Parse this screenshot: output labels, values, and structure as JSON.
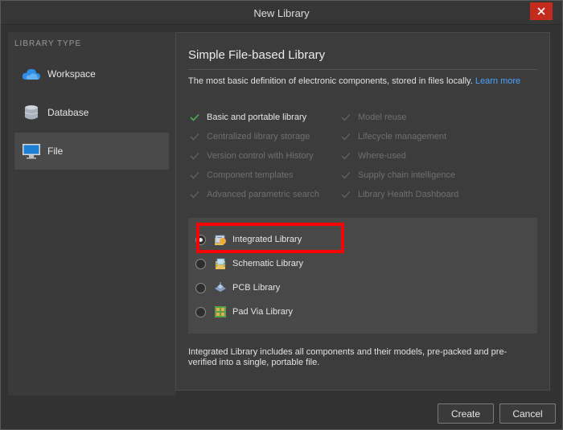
{
  "window": {
    "title": "New Library"
  },
  "sidebar": {
    "section_label": "LIBRARY TYPE",
    "items": [
      {
        "label": "Workspace",
        "icon": "cloud-icon",
        "active": false
      },
      {
        "label": "Database",
        "icon": "database-icon",
        "active": false
      },
      {
        "label": "File",
        "icon": "monitor-icon",
        "active": true
      }
    ]
  },
  "content": {
    "heading": "Simple File-based Library",
    "description": "The most basic definition of electronic components, stored in files locally.",
    "learn_more": "Learn more",
    "features_left": [
      {
        "label": "Basic and portable library",
        "enabled": true
      },
      {
        "label": "Centralized library storage",
        "enabled": false
      },
      {
        "label": "Version control with History",
        "enabled": false
      },
      {
        "label": "Component templates",
        "enabled": false
      },
      {
        "label": "Advanced parametric search",
        "enabled": false
      }
    ],
    "features_right": [
      {
        "label": "Model reuse",
        "enabled": false
      },
      {
        "label": "Lifecycle management",
        "enabled": false
      },
      {
        "label": "Where-used",
        "enabled": false
      },
      {
        "label": "Supply chain intelligence",
        "enabled": false
      },
      {
        "label": "Library Health Dashboard",
        "enabled": false
      }
    ],
    "options": [
      {
        "label": "Integrated Library",
        "icon": "integrated-library-icon",
        "selected": true
      },
      {
        "label": "Schematic Library",
        "icon": "schematic-library-icon",
        "selected": false
      },
      {
        "label": "PCB Library",
        "icon": "pcb-library-icon",
        "selected": false
      },
      {
        "label": "Pad Via Library",
        "icon": "pad-via-library-icon",
        "selected": false
      }
    ],
    "footnote": "Integrated Library includes all components and their models, pre-packed and pre-verified into a single, portable file."
  },
  "buttons": {
    "create": "Create",
    "cancel": "Cancel"
  },
  "colors": {
    "accent_link": "#4aa3ff",
    "check_enabled": "#4caf50",
    "highlight": "#ff0000",
    "close": "#c42b1c"
  }
}
